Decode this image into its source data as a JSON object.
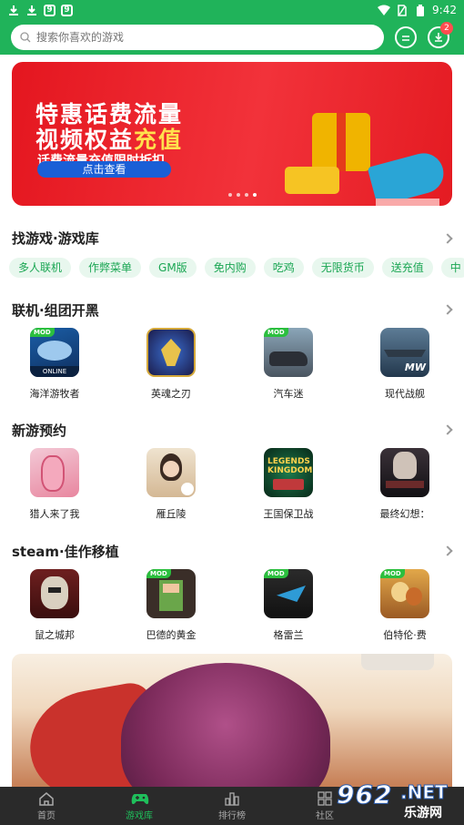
{
  "status_bar": {
    "time": "9:42",
    "left_icons": [
      "download-icon",
      "download-icon",
      "app-9-icon",
      "app-9-icon"
    ],
    "right_icons": [
      "wifi-icon",
      "no-sim-icon",
      "battery-icon"
    ]
  },
  "search": {
    "placeholder": "搜索你喜欢的游戏"
  },
  "header": {
    "download_badge": "2",
    "accent_color": "#20b35a"
  },
  "banner": {
    "line1": "特惠话费流量",
    "line2_prefix": "视频权益",
    "line2_highlight": "充值",
    "line3": "话费流量充值限时折扣",
    "cta": "点击查看",
    "page_count": 4,
    "current_page": 4
  },
  "sections": {
    "categories": {
      "title": "找游戏·游戏库",
      "tags": [
        "多人联机",
        "作弊菜单",
        "GM版",
        "免内购",
        "吃鸡",
        "无限货币",
        "送充值",
        "中"
      ]
    },
    "multiplayer": {
      "title": "联机·组团开黑",
      "apps": [
        {
          "name": "海洋游牧者",
          "mod": true,
          "icon": "ocean-nomad-icon"
        },
        {
          "name": "英魂之刃",
          "mod": false,
          "icon": "hero-blade-icon"
        },
        {
          "name": "汽车迷",
          "mod": true,
          "icon": "car-fan-icon"
        },
        {
          "name": "现代战舰",
          "mod": false,
          "icon": "modern-warships-icon"
        }
      ]
    },
    "upcoming": {
      "title": "新游预约",
      "apps": [
        {
          "name": "猎人来了我",
          "mod": false,
          "icon": "hunter-icon"
        },
        {
          "name": "雁丘陵",
          "mod": false,
          "icon": "goose-hill-icon"
        },
        {
          "name": "王国保卫战",
          "mod": false,
          "icon": "kingdom-rush-icon"
        },
        {
          "name": "最终幻想：",
          "mod": false,
          "icon": "final-fantasy-icon"
        }
      ]
    },
    "steam": {
      "title": "steam·佳作移植",
      "apps": [
        {
          "name": "鼠之城邦",
          "mod": false,
          "icon": "rat-city-icon"
        },
        {
          "name": "巴德的黄金",
          "mod": true,
          "icon": "bard-gold-icon"
        },
        {
          "name": "格雷兰",
          "mod": true,
          "icon": "greyland-icon"
        },
        {
          "name": "伯特伦·费",
          "mod": true,
          "icon": "bertram-icon"
        }
      ]
    }
  },
  "feature_logo": "",
  "bottom_nav": [
    {
      "label": "首页",
      "icon": "home-icon",
      "active": false
    },
    {
      "label": "游戏库",
      "icon": "gamepad-icon",
      "active": true
    },
    {
      "label": "排行榜",
      "icon": "ranking-icon",
      "active": false
    },
    {
      "label": "社区",
      "icon": "community-icon",
      "active": false
    }
  ],
  "watermark": {
    "number": "962",
    "suffix": ".NET",
    "cn": "乐游网"
  }
}
